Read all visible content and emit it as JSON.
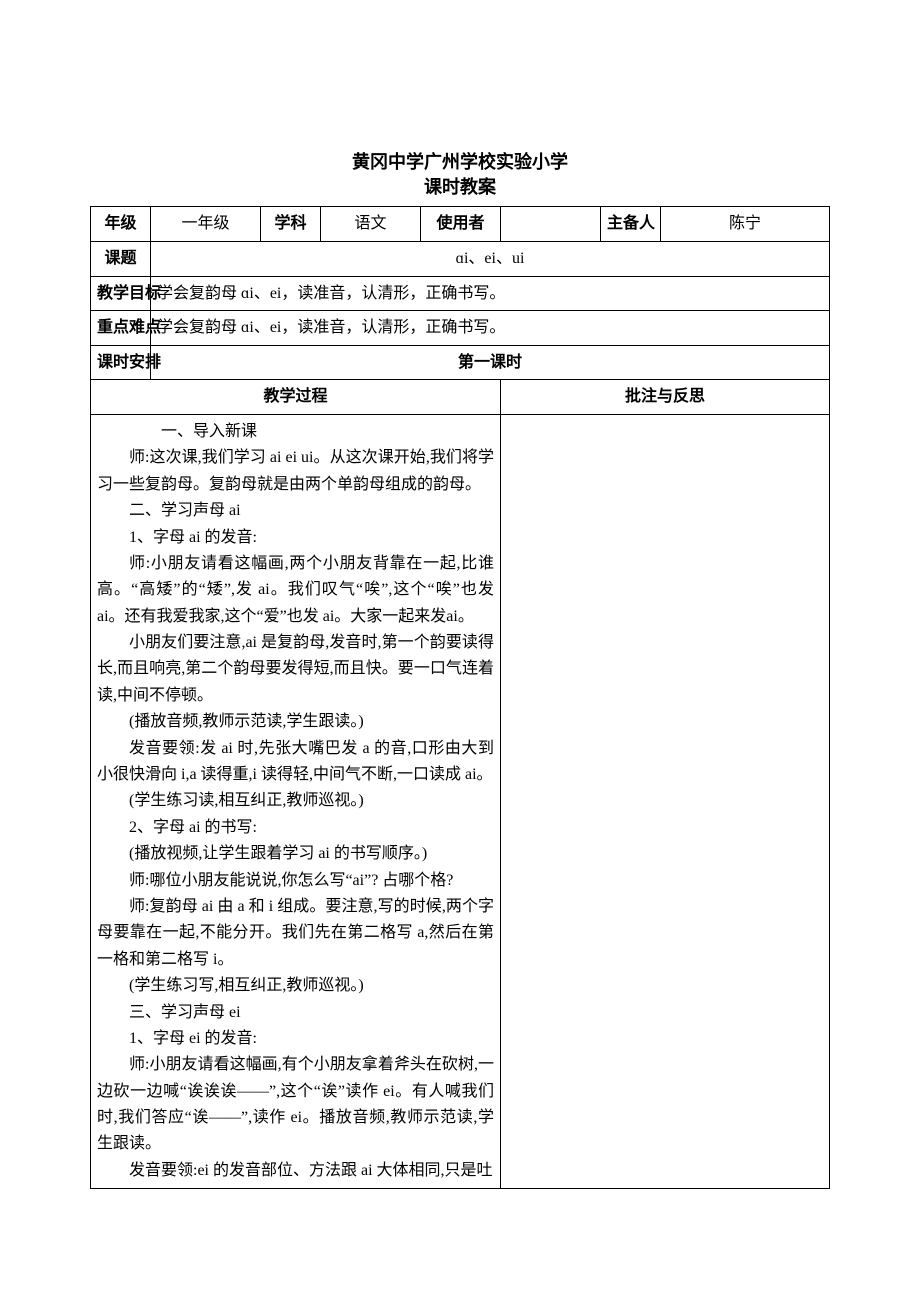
{
  "header": {
    "school": "黄冈中学广州学校实验小学",
    "doc_type": "课时教案"
  },
  "meta": {
    "grade_label": "年级",
    "grade_value": "一年级",
    "subject_label": "学科",
    "subject_value": "语文",
    "user_label": "使用者",
    "user_value": "",
    "author_label": "主备人",
    "author_value": "陈宁",
    "topic_label": "课题",
    "topic_value": "ɑi、ei、ui",
    "goals_label": "教学目标",
    "goals_value": "学会复韵母 ɑi、ei，读准音，认清形，正确书写。",
    "keypoints_label": "重点难点",
    "keypoints_value": "学会复韵母 ɑi、ei，读准音，认清形，正确书写。",
    "schedule_label": "课时安排",
    "schedule_value": "第一课时",
    "process_header": "教学过程",
    "notes_header": "批注与反思"
  },
  "process": {
    "p01": "一、导入新课",
    "p02": "师:这次课,我们学习 ai ei ui。从这次课开始,我们将学习一些复韵母。复韵母就是由两个单韵母组成的韵母。",
    "p03": "二、学习声母 ai",
    "p04": "1、字母 ai 的发音:",
    "p05": "师:小朋友请看这幅画,两个小朋友背靠在一起,比谁高。“高矮”的“矮”,发 ai。我们叹气“唉”,这个“唉”也发 ai。还有我爱我家,这个“爱”也发 ai。大家一起来发ai。",
    "p06": "小朋友们要注意,ai 是复韵母,发音时,第一个韵要读得长,而且响亮,第二个韵母要发得短,而且快。要一口气连着读,中间不停顿。",
    "p07": "(播放音频,教师示范读,学生跟读。)",
    "p08": "发音要领:发 ai 时,先张大嘴巴发 a 的音,口形由大到小很快滑向 i,a 读得重,i 读得轻,中间气不断,一口读成 ai。",
    "p09": "(学生练习读,相互纠正,教师巡视。)",
    "p10": "2、字母 ai 的书写:",
    "p11": "(播放视频,让学生跟着学习 ai 的书写顺序。)",
    "p12": "师:哪位小朋友能说说,你怎么写“ai”? 占哪个格?",
    "p13": "师:复韵母 ai 由 a 和 i 组成。要注意,写的时候,两个字母要靠在一起,不能分开。我们先在第二格写 a,然后在第一格和第二格写 i。",
    "p14": "(学生练习写,相互纠正,教师巡视。)",
    "p15": "三、学习声母 ei",
    "p16": "1、字母 ei 的发音:",
    "p17": "师:小朋友请看这幅画,有个小朋友拿着斧头在砍树,一边砍一边喊“诶诶诶——”,这个“诶”读作 ei。有人喊我们时,我们答应“诶——”,读作 ei。播放音频,教师示范读,学生跟读。",
    "p18": "发音要领:ei 的发音部位、方法跟 ai 大体相同,只是吐"
  }
}
